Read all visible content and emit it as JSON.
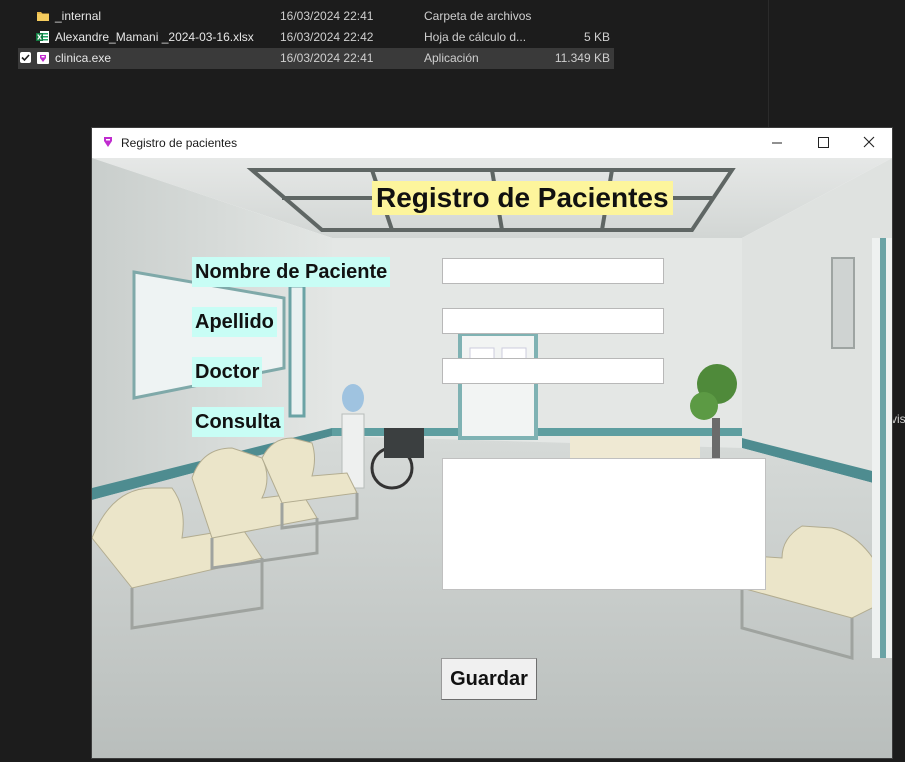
{
  "explorer": {
    "files": [
      {
        "name": "_internal",
        "date": "16/03/2024 22:41",
        "type": "Carpeta de archivos",
        "size": "",
        "icon": "folder-icon"
      },
      {
        "name": "Alexandre_Mamani _2024-03-16.xlsx",
        "date": "16/03/2024 22:42",
        "type": "Hoja de cálculo d...",
        "size": "5 KB",
        "icon": "excel-icon"
      },
      {
        "name": "clinica.exe",
        "date": "16/03/2024 22:41",
        "type": "Aplicación",
        "size": "11.349 KB",
        "icon": "exe-icon",
        "selected": true
      }
    ],
    "side_text": "vis"
  },
  "window": {
    "title": "Registro de pacientes",
    "minimize_glyph": "—",
    "maximize_glyph": "☐",
    "close_glyph": "✕"
  },
  "form": {
    "heading": "Registro de Pacientes",
    "labels": {
      "nombre": "Nombre de Paciente",
      "apellido": "Apellido",
      "doctor": "Doctor",
      "consulta": "Consulta"
    },
    "values": {
      "nombre": "",
      "apellido": "",
      "doctor": "",
      "consulta": ""
    },
    "save_label": "Guardar"
  },
  "colors": {
    "heading_bg": "#fdf59c",
    "label_bg": "#c8fdf5",
    "explorer_bg": "#1c1c1c"
  }
}
